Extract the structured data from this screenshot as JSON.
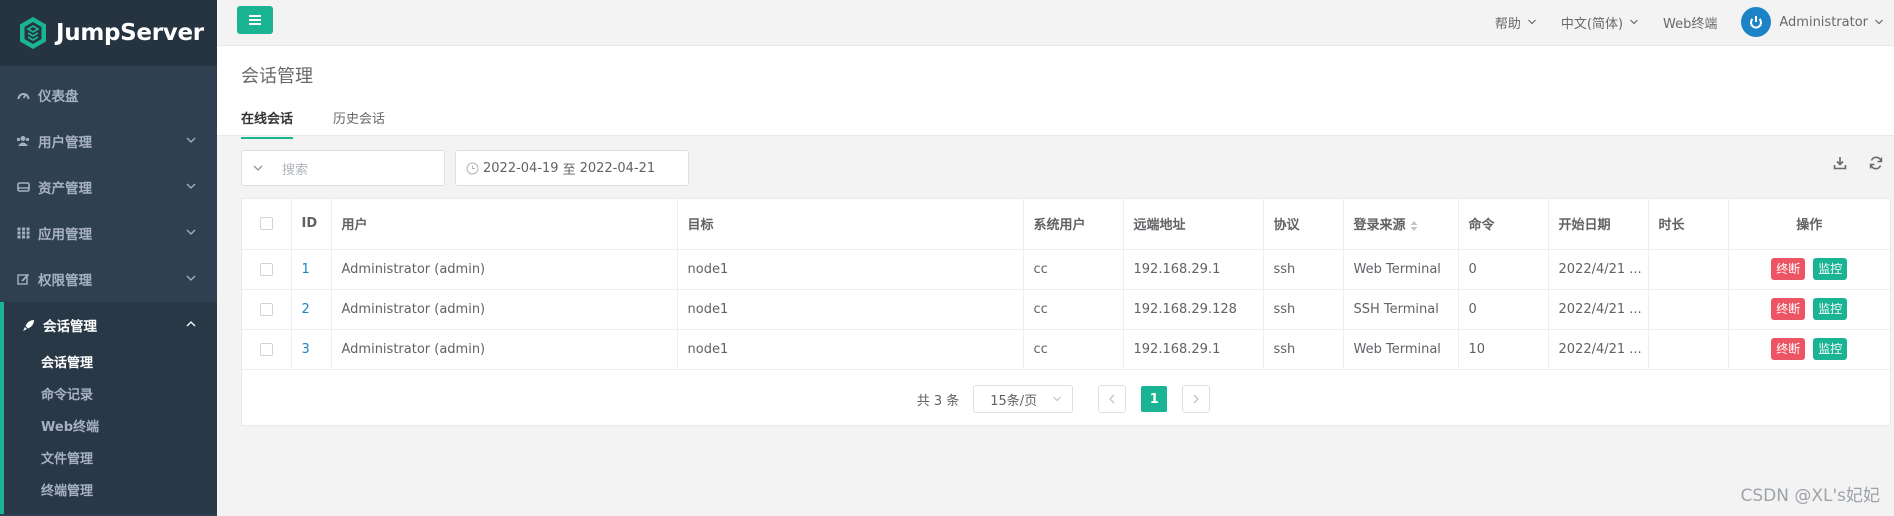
{
  "brand": {
    "name": "JumpServer"
  },
  "sidebar": {
    "items": [
      {
        "label": "仪表盘",
        "icon": "dashboard-icon"
      },
      {
        "label": "用户管理",
        "icon": "users-icon"
      },
      {
        "label": "资产管理",
        "icon": "inbox-icon"
      },
      {
        "label": "应用管理",
        "icon": "grid-icon"
      },
      {
        "label": "权限管理",
        "icon": "edit-icon"
      },
      {
        "label": "会话管理",
        "icon": "rocket-icon"
      }
    ],
    "subitems": [
      "会话管理",
      "命令记录",
      "Web终端",
      "文件管理",
      "终端管理"
    ]
  },
  "topbar": {
    "help": "帮助",
    "language": "中文(简体)",
    "web_terminal": "Web终端",
    "user": "Administrator"
  },
  "page": {
    "title": "会话管理",
    "tabs": [
      "在线会话",
      "历史会话"
    ]
  },
  "filter": {
    "search_placeholder": "搜索",
    "date_start": "2022-04-19",
    "date_sep": "至",
    "date_end": "2022-04-21"
  },
  "table": {
    "headers": [
      "ID",
      "用户",
      "目标",
      "系统用户",
      "远端地址",
      "协议",
      "登录来源",
      "命令",
      "开始日期",
      "时长",
      "操作"
    ],
    "rows": [
      {
        "id": "1",
        "user": "Administrator (admin)",
        "target": "node1",
        "sysuser": "cc",
        "addr": "192.168.29.1",
        "proto": "ssh",
        "source": "Web Terminal",
        "cmds": "0",
        "date": "2022/4/21 ...",
        "duration": ""
      },
      {
        "id": "2",
        "user": "Administrator (admin)",
        "target": "node1",
        "sysuser": "cc",
        "addr": "192.168.29.128",
        "proto": "ssh",
        "source": "SSH Terminal",
        "cmds": "0",
        "date": "2022/4/21 ...",
        "duration": ""
      },
      {
        "id": "3",
        "user": "Administrator (admin)",
        "target": "node1",
        "sysuser": "cc",
        "addr": "192.168.29.1",
        "proto": "ssh",
        "source": "Web Terminal",
        "cmds": "10",
        "date": "2022/4/21 ...",
        "duration": ""
      }
    ],
    "actions": {
      "terminate": "终断",
      "monitor": "监控"
    }
  },
  "pager": {
    "total": "共 3 条",
    "page_size": "15条/页",
    "current": "1"
  },
  "watermark": "CSDN @XL's妃妃",
  "colors": {
    "accent": "#1ab394",
    "sidebar": "#2f4050",
    "danger": "#ed5565",
    "link": "#1c84c6"
  }
}
